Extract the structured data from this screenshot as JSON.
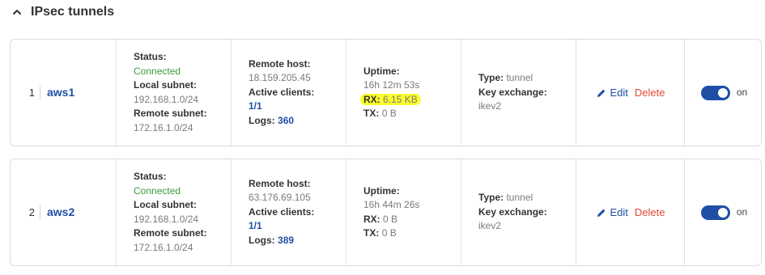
{
  "section": {
    "title": "IPsec tunnels",
    "chevron_icon": "chevron-up-icon"
  },
  "labels": {
    "status": "Status:",
    "local_subnet": "Local subnet:",
    "remote_subnet": "Remote subnet:",
    "remote_host": "Remote host:",
    "active_clients": "Active clients:",
    "logs": "Logs:",
    "uptime": "Uptime:",
    "rx": "RX:",
    "tx": "TX:",
    "type": "Type:",
    "key_exchange": "Key exchange:",
    "edit": "Edit",
    "delete": "Delete",
    "toggle_on": "on"
  },
  "colors": {
    "accent": "#1e4fa5",
    "connected": "#3a9a3a",
    "delete": "#e04a3a",
    "highlight": "#fbff2b"
  },
  "tunnels": [
    {
      "index": "1",
      "name": "aws1",
      "status": "Connected",
      "local_subnet": "192.168.1.0/24",
      "remote_subnet": "172.16.1.0/24",
      "remote_host": "18.159.205.45",
      "active_clients": "1/1",
      "logs": "360",
      "uptime": "16h 12m 53s",
      "rx": "6.15 KB",
      "tx": "0 B",
      "type": "tunnel",
      "key_exchange": "ikev2",
      "enabled": true
    },
    {
      "index": "2",
      "name": "aws2",
      "status": "Connected",
      "local_subnet": "192.168.1.0/24",
      "remote_subnet": "172.16.1.0/24",
      "remote_host": "63.176.69.105",
      "active_clients": "1/1",
      "logs": "389",
      "uptime": "16h 44m 26s",
      "rx": "0 B",
      "tx": "0 B",
      "type": "tunnel",
      "key_exchange": "ikev2",
      "enabled": true
    }
  ]
}
